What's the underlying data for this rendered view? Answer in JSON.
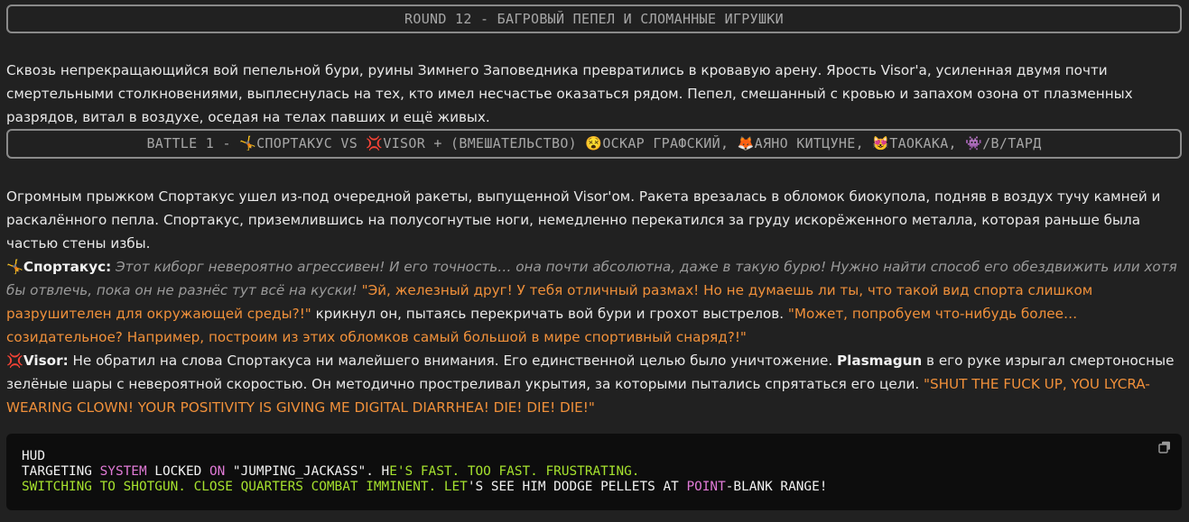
{
  "round_header": "ROUND 12 - БАГРОВЫЙ ПЕПЕЛ И СЛОМАННЫЕ ИГРУШКИ",
  "intro": "Сквозь непрекращающийся вой пепельной бури, руины Зимнего Заповедника превратились в кровавую арену. Ярость Visor'a, усиленная двумя почти смертельными столкновениями, выплеснулась на тех, кто имел несчастье оказаться рядом. Пепел, смешанный с кровью и запахом озона от плазменных разрядов, витал в воздухе, оседая на телах павших и ещё живых.",
  "battle_header": {
    "prefix": "BATTLE 1 - ",
    "emoji_sportakus": "🤸",
    "sportakus": "СПОРТАКУС",
    "vs": " VS ",
    "emoji_visor": "💢",
    "visor_interference": "VISOR + (ВМЕШАТЕЛЬСТВО) ",
    "emoji_oskar": "😵",
    "oskar": "ОСКАР ГРАФСКИЙ, ",
    "emoji_ayano": "🦊",
    "ayano": "АЯНО КИТЦУНЕ, ",
    "emoji_taokaka": "😻",
    "taokaka": "ТАОКАКА, ",
    "emoji_btard": "👾",
    "btard": "/В/ТАРД"
  },
  "narrative": "Огромным прыжком Спортакус ушел из-под очередной ракеты, выпущенной Visor'ом. Ракета врезалась в обломок биокупола, подняв в воздух тучу камней и раскалённого пепла. Спортакус, приземлившись на полусогнутые ноги, немедленно перекатился за груду искорёженного металла, которая раньше была частью стены избы.",
  "sportakus_line": {
    "emoji": "🤸",
    "speaker": "Спортакус:",
    "thought": " Этот киборг невероятно агрессивен! И его точность… она почти абсолютна, даже в такую бурю! Нужно найти способ его обездвижить или хотя бы отвлечь, пока он не разнёс тут всё на куски! ",
    "quote1": "\"Эй, железный друг! У тебя отличный размах! Но не думаешь ли ты, что такой вид спорта слишком разрушителен для окружающей среды?!\"",
    "between": " крикнул он, пытаясь перекричать вой бури и грохот выстрелов. ",
    "quote2": "\"Может, попробуем что-нибудь более… созидательное? Например, построим из этих обломков самый большой в мире спортивный снаряд?!\""
  },
  "visor_line": {
    "emoji": "💢",
    "speaker": "Visor:",
    "text1": " Не обратил на слова Спортакуса ни малейшего внимания. Его единственной целью было уничтожение. ",
    "weapon": "Plasmagun",
    "text2": " в его руке изрыгал смертоносные зелёные шары с невероятной скоростью. Он методично простреливал укрытия, за которыми пытались спрятаться его цели. ",
    "quote": "\"SHUT THE FUCK UP, YOU LYCRA-WEARING CLOWN! YOUR POSITIVITY IS GIVING ME DIGITAL DIARRHEA! DIE! DIE! DIE!\""
  },
  "hud": {
    "l1": "HUD",
    "l2_a": "TARGETING ",
    "l2_b": "SYSTEM",
    "l2_c": " LOCKED ",
    "l2_d": "ON",
    "l2_e": " \"JUMPING_JACKASS\". H",
    "l2_f": "E'S FAST. TOO FAST. FRUSTRATING.",
    "l3_a": "SWITCHING TO SHOTGUN. CLOSE QUARTERS COMBAT IMMINENT. LET",
    "l3_b": "'S SEE HIM DODGE PELLETS AT ",
    "l3_c": "POINT",
    "l3_d": "-BLANK RANGE!",
    "copy_icon": "copy-icon"
  }
}
